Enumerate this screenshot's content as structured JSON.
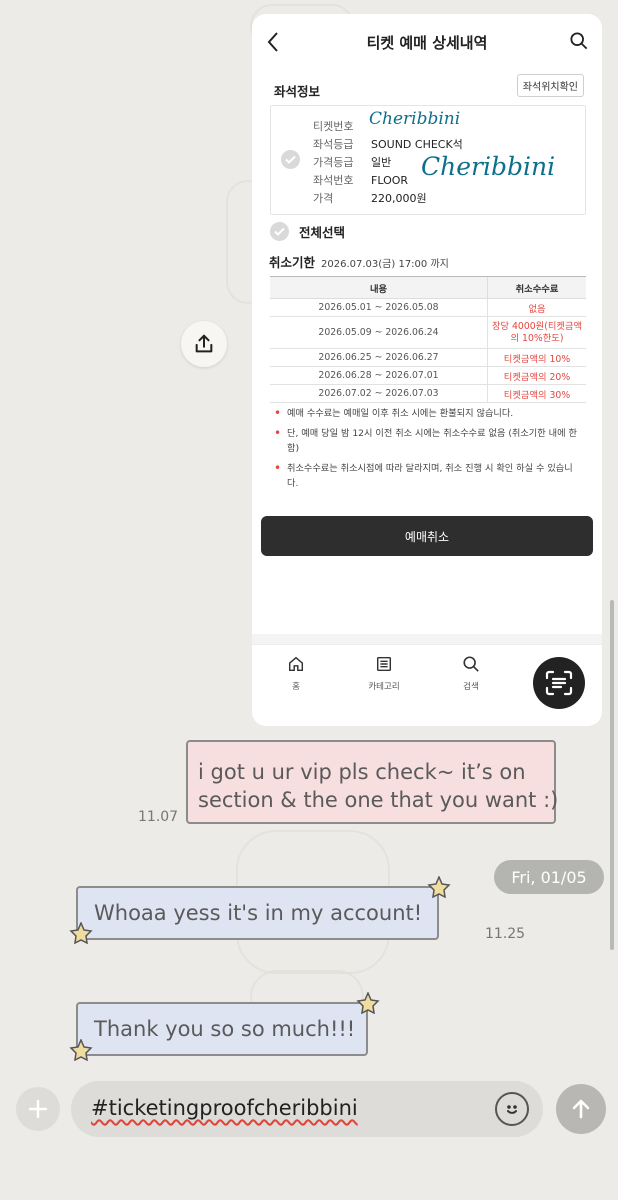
{
  "ticket": {
    "title": "티켓 예매 상세내역",
    "seat_section_title": "좌석정보",
    "seat_location_button": "좌석위치확인",
    "fields": [
      {
        "label": "티켓번호",
        "value": ""
      },
      {
        "label": "좌석등급",
        "value": "SOUND CHECK석"
      },
      {
        "label": "가격등급",
        "value": "일반"
      },
      {
        "label": "좌석번호",
        "value": "FLOOR"
      },
      {
        "label": "가격",
        "value": "220,000원"
      }
    ],
    "signatures": [
      "Cheribbini",
      "Cheribbini"
    ],
    "select_all": "전체선택",
    "deadline_label": "취소기한",
    "deadline_date": "2026.07.03(금) 17:00 까지",
    "table_headers": {
      "period": "내용",
      "fee": "취소수수료"
    },
    "table_rows": [
      {
        "period": "2026.05.01 ~ 2026.05.08",
        "fee": "없음"
      },
      {
        "period": "2026.05.09 ~ 2026.06.24",
        "fee": "장당 4000원(티켓금액의 10%한도)"
      },
      {
        "period": "2026.06.25 ~ 2026.06.27",
        "fee": "티켓금액의 10%"
      },
      {
        "period": "2026.06.28 ~ 2026.07.01",
        "fee": "티켓금액의 20%"
      },
      {
        "period": "2026.07.02 ~ 2026.07.03",
        "fee": "티켓금액의 30%"
      }
    ],
    "notes": [
      "예매 수수료는 예매일 이후 취소 시에는 환불되지 않습니다.",
      "단, 예매 당일 밤 12시 이전 취소 시에는 취소수수료 없음 (취소기한 내에 한함)",
      "취소수수료는 취소시점에 따라 달라지며, 취소 진행 시 확인 하실 수 있습니다."
    ],
    "cancel_button": "예매취소",
    "nav": [
      {
        "label": "홈",
        "icon": "home-icon"
      },
      {
        "label": "카테고리",
        "icon": "category-icon"
      },
      {
        "label": "검색",
        "icon": "search-icon"
      }
    ]
  },
  "chat": {
    "messages": [
      {
        "text_line1": "i got u ur vip pls check~ it’s on",
        "text_line2": "section & the one that you want :)",
        "time": "11.07"
      },
      {
        "date": "Fri, 01/05"
      },
      {
        "text": "Whoaa yess it's in my account!",
        "time": "11.25"
      },
      {
        "text": "Thank you so so much!!!"
      }
    ],
    "input_value": "#ticketingproofcheribbini"
  },
  "colors": {
    "pink_bubble": "#f7dedf",
    "blue_bubble": "#dfe4f3",
    "fee_red": "#e6453d",
    "chat_background": "#ecebe7"
  }
}
